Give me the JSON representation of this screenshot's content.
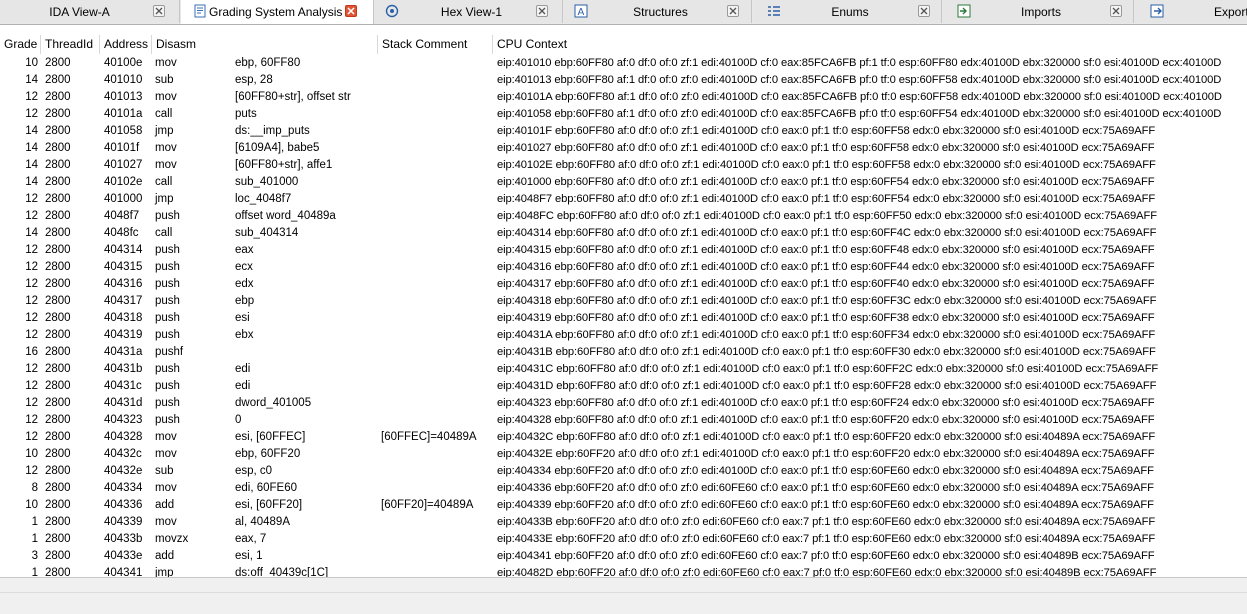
{
  "tabs": [
    {
      "label": "IDA View-A",
      "icon": "ida-view-icon",
      "active": false
    },
    {
      "label": "Grading System Analysis",
      "icon": "analysis-doc-icon",
      "active": true
    },
    {
      "label": "Hex View-1",
      "icon": "hex-view-icon",
      "active": false
    },
    {
      "label": "Structures",
      "icon": "structures-icon",
      "active": false
    },
    {
      "label": "Enums",
      "icon": "enums-icon",
      "active": false
    },
    {
      "label": "Imports",
      "icon": "imports-icon",
      "active": false
    },
    {
      "label": "Export",
      "icon": "exports-icon",
      "active": false
    }
  ],
  "columns": [
    "Grade",
    "ThreadId",
    "Address",
    "Disasm",
    "Stack Comment",
    "CPU Context"
  ],
  "rows": [
    {
      "grade": "10",
      "tid": "2800",
      "addr": "40100e",
      "mn": "mov",
      "op": "ebp, 60FF80",
      "sc": "",
      "ctx": "eip:401010 ebp:60FF80 af:0 df:0 of:0 zf:1 edi:40100D cf:0 eax:85FCA6FB pf:1 tf:0 esp:60FF80 edx:40100D ebx:320000 sf:0 esi:40100D ecx:40100D"
    },
    {
      "grade": "14",
      "tid": "2800",
      "addr": "401010",
      "mn": "sub",
      "op": "esp, 28",
      "sc": "",
      "ctx": "eip:401013 ebp:60FF80 af:1 df:0 of:0 zf:0 edi:40100D cf:0 eax:85FCA6FB pf:0 tf:0 esp:60FF58 edx:40100D ebx:320000 sf:0 esi:40100D ecx:40100D"
    },
    {
      "grade": "12",
      "tid": "2800",
      "addr": "401013",
      "mn": "mov",
      "op": "[60FF80+str], offset str",
      "sc": "",
      "ctx": "eip:40101A ebp:60FF80 af:1 df:0 of:0 zf:0 edi:40100D cf:0 eax:85FCA6FB pf:0 tf:0 esp:60FF58 edx:40100D ebx:320000 sf:0 esi:40100D ecx:40100D"
    },
    {
      "grade": "12",
      "tid": "2800",
      "addr": "40101a",
      "mn": "call",
      "op": "puts",
      "sc": "",
      "ctx": "eip:401058 ebp:60FF80 af:1 df:0 of:0 zf:0 edi:40100D cf:0 eax:85FCA6FB pf:0 tf:0 esp:60FF54 edx:40100D ebx:320000 sf:0 esi:40100D ecx:40100D"
    },
    {
      "grade": "14",
      "tid": "2800",
      "addr": "401058",
      "mn": "jmp",
      "op": "ds:__imp_puts",
      "sc": "",
      "ctx": "eip:40101F ebp:60FF80 af:0 df:0 of:0 zf:1 edi:40100D cf:0 eax:0 pf:1 tf:0 esp:60FF58 edx:0 ebx:320000 sf:0 esi:40100D ecx:75A69AFF"
    },
    {
      "grade": "14",
      "tid": "2800",
      "addr": "40101f",
      "mn": "mov",
      "op": "[6109A4], babe5",
      "sc": "",
      "ctx": "eip:401027 ebp:60FF80 af:0 df:0 of:0 zf:1 edi:40100D cf:0 eax:0 pf:1 tf:0 esp:60FF58 edx:0 ebx:320000 sf:0 esi:40100D ecx:75A69AFF"
    },
    {
      "grade": "14",
      "tid": "2800",
      "addr": "401027",
      "mn": "mov",
      "op": "[60FF80+str], affe1",
      "sc": "",
      "ctx": "eip:40102E ebp:60FF80 af:0 df:0 of:0 zf:1 edi:40100D cf:0 eax:0 pf:1 tf:0 esp:60FF58 edx:0 ebx:320000 sf:0 esi:40100D ecx:75A69AFF"
    },
    {
      "grade": "14",
      "tid": "2800",
      "addr": "40102e",
      "mn": "call",
      "op": "sub_401000",
      "sc": "",
      "ctx": "eip:401000 ebp:60FF80 af:0 df:0 of:0 zf:1 edi:40100D cf:0 eax:0 pf:1 tf:0 esp:60FF54 edx:0 ebx:320000 sf:0 esi:40100D ecx:75A69AFF"
    },
    {
      "grade": "12",
      "tid": "2800",
      "addr": "401000",
      "mn": "jmp",
      "op": "loc_4048f7",
      "sc": "",
      "ctx": "eip:4048F7 ebp:60FF80 af:0 df:0 of:0 zf:1 edi:40100D cf:0 eax:0 pf:1 tf:0 esp:60FF54 edx:0 ebx:320000 sf:0 esi:40100D ecx:75A69AFF"
    },
    {
      "grade": "12",
      "tid": "2800",
      "addr": "4048f7",
      "mn": "push",
      "op": "offset word_40489a",
      "sc": "",
      "ctx": "eip:4048FC ebp:60FF80 af:0 df:0 of:0 zf:1 edi:40100D cf:0 eax:0 pf:1 tf:0 esp:60FF50 edx:0 ebx:320000 sf:0 esi:40100D ecx:75A69AFF"
    },
    {
      "grade": "14",
      "tid": "2800",
      "addr": "4048fc",
      "mn": "call",
      "op": "sub_404314",
      "sc": "",
      "ctx": "eip:404314 ebp:60FF80 af:0 df:0 of:0 zf:1 edi:40100D cf:0 eax:0 pf:1 tf:0 esp:60FF4C edx:0 ebx:320000 sf:0 esi:40100D ecx:75A69AFF"
    },
    {
      "grade": "12",
      "tid": "2800",
      "addr": "404314",
      "mn": "push",
      "op": "eax",
      "sc": "",
      "ctx": "eip:404315 ebp:60FF80 af:0 df:0 of:0 zf:1 edi:40100D cf:0 eax:0 pf:1 tf:0 esp:60FF48 edx:0 ebx:320000 sf:0 esi:40100D ecx:75A69AFF"
    },
    {
      "grade": "12",
      "tid": "2800",
      "addr": "404315",
      "mn": "push",
      "op": "ecx",
      "sc": "",
      "ctx": "eip:404316 ebp:60FF80 af:0 df:0 of:0 zf:1 edi:40100D cf:0 eax:0 pf:1 tf:0 esp:60FF44 edx:0 ebx:320000 sf:0 esi:40100D ecx:75A69AFF"
    },
    {
      "grade": "12",
      "tid": "2800",
      "addr": "404316",
      "mn": "push",
      "op": "edx",
      "sc": "",
      "ctx": "eip:404317 ebp:60FF80 af:0 df:0 of:0 zf:1 edi:40100D cf:0 eax:0 pf:1 tf:0 esp:60FF40 edx:0 ebx:320000 sf:0 esi:40100D ecx:75A69AFF"
    },
    {
      "grade": "12",
      "tid": "2800",
      "addr": "404317",
      "mn": "push",
      "op": "ebp",
      "sc": "",
      "ctx": "eip:404318 ebp:60FF80 af:0 df:0 of:0 zf:1 edi:40100D cf:0 eax:0 pf:1 tf:0 esp:60FF3C edx:0 ebx:320000 sf:0 esi:40100D ecx:75A69AFF"
    },
    {
      "grade": "12",
      "tid": "2800",
      "addr": "404318",
      "mn": "push",
      "op": "esi",
      "sc": "",
      "ctx": "eip:404319 ebp:60FF80 af:0 df:0 of:0 zf:1 edi:40100D cf:0 eax:0 pf:1 tf:0 esp:60FF38 edx:0 ebx:320000 sf:0 esi:40100D ecx:75A69AFF"
    },
    {
      "grade": "12",
      "tid": "2800",
      "addr": "404319",
      "mn": "push",
      "op": "ebx",
      "sc": "",
      "ctx": "eip:40431A ebp:60FF80 af:0 df:0 of:0 zf:1 edi:40100D cf:0 eax:0 pf:1 tf:0 esp:60FF34 edx:0 ebx:320000 sf:0 esi:40100D ecx:75A69AFF"
    },
    {
      "grade": "16",
      "tid": "2800",
      "addr": "40431a",
      "mn": "pushf",
      "op": "",
      "sc": "",
      "ctx": "eip:40431B ebp:60FF80 af:0 df:0 of:0 zf:1 edi:40100D cf:0 eax:0 pf:1 tf:0 esp:60FF30 edx:0 ebx:320000 sf:0 esi:40100D ecx:75A69AFF"
    },
    {
      "grade": "12",
      "tid": "2800",
      "addr": "40431b",
      "mn": "push",
      "op": "edi",
      "sc": "",
      "ctx": "eip:40431C ebp:60FF80 af:0 df:0 of:0 zf:1 edi:40100D cf:0 eax:0 pf:1 tf:0 esp:60FF2C edx:0 ebx:320000 sf:0 esi:40100D ecx:75A69AFF"
    },
    {
      "grade": "12",
      "tid": "2800",
      "addr": "40431c",
      "mn": "push",
      "op": "edi",
      "sc": "",
      "ctx": "eip:40431D ebp:60FF80 af:0 df:0 of:0 zf:1 edi:40100D cf:0 eax:0 pf:1 tf:0 esp:60FF28 edx:0 ebx:320000 sf:0 esi:40100D ecx:75A69AFF"
    },
    {
      "grade": "12",
      "tid": "2800",
      "addr": "40431d",
      "mn": "push",
      "op": "dword_401005",
      "sc": "",
      "ctx": "eip:404323 ebp:60FF80 af:0 df:0 of:0 zf:1 edi:40100D cf:0 eax:0 pf:1 tf:0 esp:60FF24 edx:0 ebx:320000 sf:0 esi:40100D ecx:75A69AFF"
    },
    {
      "grade": "12",
      "tid": "2800",
      "addr": "404323",
      "mn": "push",
      "op": "0",
      "sc": "",
      "ctx": "eip:404328 ebp:60FF80 af:0 df:0 of:0 zf:1 edi:40100D cf:0 eax:0 pf:1 tf:0 esp:60FF20 edx:0 ebx:320000 sf:0 esi:40100D ecx:75A69AFF"
    },
    {
      "grade": "12",
      "tid": "2800",
      "addr": "404328",
      "mn": "mov",
      "op": "esi, [60FFEC]",
      "sc": "[60FFEC]=40489A",
      "ctx": "eip:40432C ebp:60FF80 af:0 df:0 of:0 zf:1 edi:40100D cf:0 eax:0 pf:1 tf:0 esp:60FF20 edx:0 ebx:320000 sf:0 esi:40489A ecx:75A69AFF"
    },
    {
      "grade": "10",
      "tid": "2800",
      "addr": "40432c",
      "mn": "mov",
      "op": "ebp, 60FF20",
      "sc": "",
      "ctx": "eip:40432E ebp:60FF20 af:0 df:0 of:0 zf:1 edi:40100D cf:0 eax:0 pf:1 tf:0 esp:60FF20 edx:0 ebx:320000 sf:0 esi:40489A ecx:75A69AFF"
    },
    {
      "grade": "12",
      "tid": "2800",
      "addr": "40432e",
      "mn": "sub",
      "op": "esp, c0",
      "sc": "",
      "ctx": "eip:404334 ebp:60FF20 af:0 df:0 of:0 zf:0 edi:40100D cf:0 eax:0 pf:1 tf:0 esp:60FE60 edx:0 ebx:320000 sf:0 esi:40489A ecx:75A69AFF"
    },
    {
      "grade": "8",
      "tid": "2800",
      "addr": "404334",
      "mn": "mov",
      "op": "edi, 60FE60",
      "sc": "",
      "ctx": "eip:404336 ebp:60FF20 af:0 df:0 of:0 zf:0 edi:60FE60 cf:0 eax:0 pf:1 tf:0 esp:60FE60 edx:0 ebx:320000 sf:0 esi:40489A ecx:75A69AFF"
    },
    {
      "grade": "10",
      "tid": "2800",
      "addr": "404336",
      "mn": "add",
      "op": "esi, [60FF20]",
      "sc": "[60FF20]=40489A",
      "ctx": "eip:404339 ebp:60FF20 af:0 df:0 of:0 zf:0 edi:60FE60 cf:0 eax:0 pf:1 tf:0 esp:60FE60 edx:0 ebx:320000 sf:0 esi:40489A ecx:75A69AFF"
    },
    {
      "grade": "1",
      "tid": "2800",
      "addr": "404339",
      "mn": "mov",
      "op": "al, 40489A",
      "sc": "",
      "ctx": "eip:40433B ebp:60FF20 af:0 df:0 of:0 zf:0 edi:60FE60 cf:0 eax:7 pf:1 tf:0 esp:60FE60 edx:0 ebx:320000 sf:0 esi:40489A ecx:75A69AFF"
    },
    {
      "grade": "1",
      "tid": "2800",
      "addr": "40433b",
      "mn": "movzx",
      "op": "eax, 7",
      "sc": "",
      "ctx": "eip:40433E ebp:60FF20 af:0 df:0 of:0 zf:0 edi:60FE60 cf:0 eax:7 pf:1 tf:0 esp:60FE60 edx:0 ebx:320000 sf:0 esi:40489A ecx:75A69AFF"
    },
    {
      "grade": "3",
      "tid": "2800",
      "addr": "40433e",
      "mn": "add",
      "op": "esi, 1",
      "sc": "",
      "ctx": "eip:404341 ebp:60FF20 af:0 df:0 of:0 zf:0 edi:60FE60 cf:0 eax:7 pf:0 tf:0 esp:60FE60 edx:0 ebx:320000 sf:0 esi:40489B ecx:75A69AFF"
    },
    {
      "grade": "1",
      "tid": "2800",
      "addr": "404341",
      "mn": "jmp",
      "op": "ds:off_40439c[1C]",
      "sc": "",
      "ctx": "eip:40482D ebp:60FF20 af:0 df:0 of:0 zf:0 edi:60FE60 cf:0 eax:7 pf:0 tf:0 esp:60FE60 edx:0 ebx:320000 sf:0 esi:40489B ecx:75A69AFF"
    }
  ]
}
